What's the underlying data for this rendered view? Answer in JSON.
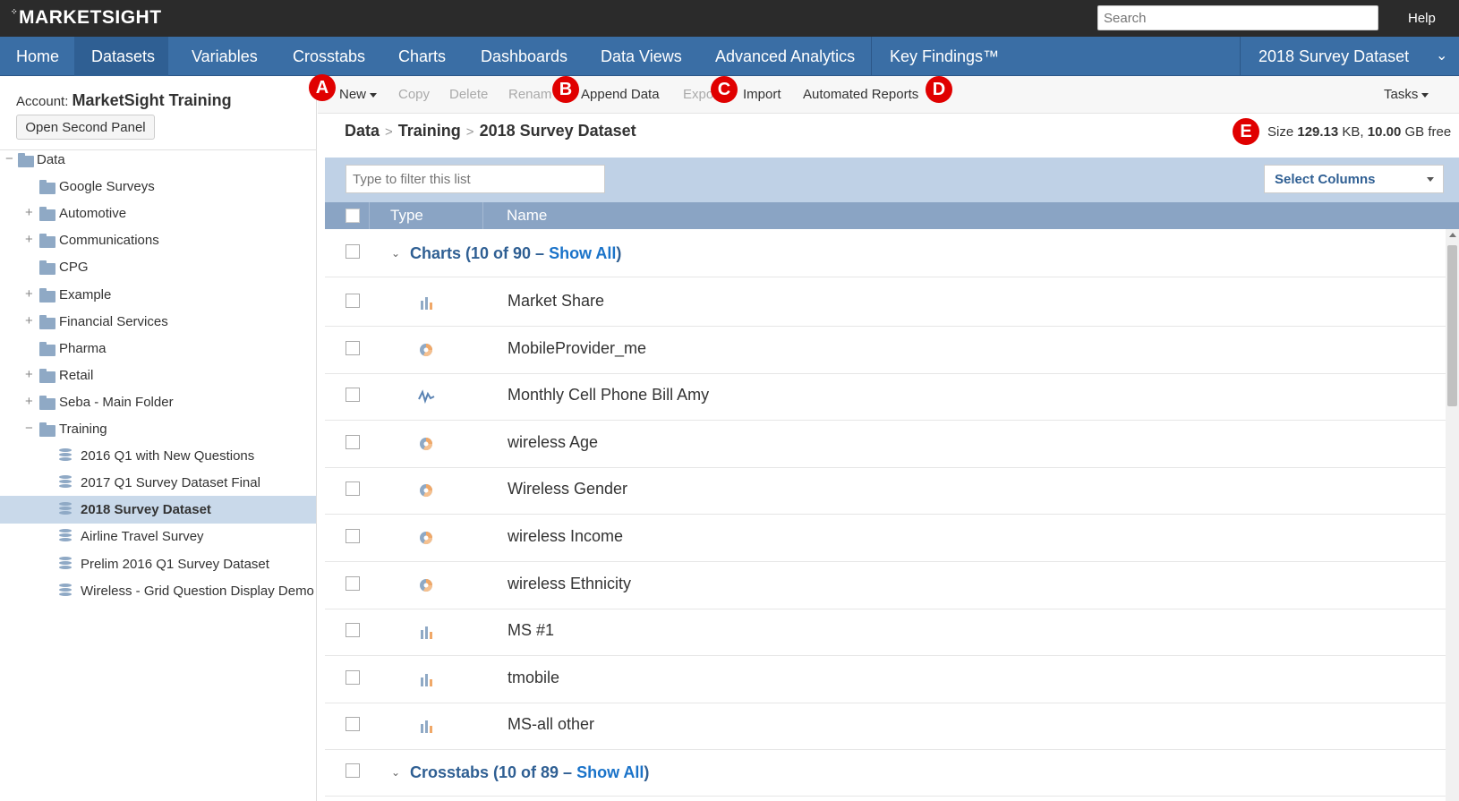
{
  "app": {
    "logo": "MARKETSIGHT",
    "search_placeholder": "Search",
    "help": "Help"
  },
  "nav": {
    "items": [
      "Home",
      "Datasets",
      "Variables",
      "Crosstabs",
      "Charts",
      "Dashboards",
      "Data Views",
      "Advanced Analytics",
      "Key Findings™"
    ],
    "active": "Datasets",
    "dataset_selector": "2018 Survey Dataset"
  },
  "left": {
    "account_label": "Account:",
    "account_name": "MarketSight Training",
    "open_second_panel": "Open Second Panel",
    "tree": [
      {
        "label": "Data",
        "type": "folder",
        "toggle": "−",
        "level": 0
      },
      {
        "label": "Google Surveys",
        "type": "folder",
        "toggle": "",
        "level": 1
      },
      {
        "label": "Automotive",
        "type": "folder",
        "toggle": "+",
        "level": 1
      },
      {
        "label": "Communications",
        "type": "folder",
        "toggle": "+",
        "level": 1
      },
      {
        "label": "CPG",
        "type": "folder",
        "toggle": "",
        "level": 1
      },
      {
        "label": "Example",
        "type": "folder",
        "toggle": "+",
        "level": 1
      },
      {
        "label": "Financial Services",
        "type": "folder",
        "toggle": "+",
        "level": 1
      },
      {
        "label": "Pharma",
        "type": "folder",
        "toggle": "",
        "level": 1
      },
      {
        "label": "Retail",
        "type": "folder",
        "toggle": "+",
        "level": 1
      },
      {
        "label": "Seba - Main Folder",
        "type": "folder",
        "toggle": "+",
        "level": 1
      },
      {
        "label": "Training",
        "type": "folder",
        "toggle": "−",
        "level": 1
      },
      {
        "label": "2016 Q1 with New Questions",
        "type": "dataset",
        "toggle": "",
        "level": 2
      },
      {
        "label": "2017 Q1 Survey Dataset Final",
        "type": "dataset",
        "toggle": "",
        "level": 2
      },
      {
        "label": "2018 Survey Dataset",
        "type": "dataset",
        "toggle": "",
        "level": 2,
        "selected": true
      },
      {
        "label": "Airline Travel Survey",
        "type": "dataset",
        "toggle": "",
        "level": 2
      },
      {
        "label": "Prelim 2016 Q1 Survey Dataset",
        "type": "dataset",
        "toggle": "",
        "level": 2
      },
      {
        "label": "Wireless - Grid Question Display Demo",
        "type": "dataset",
        "toggle": "",
        "level": 2
      }
    ]
  },
  "toolbar": {
    "new": "New",
    "copy": "Copy",
    "delete": "Delete",
    "rename": "Renam",
    "append": "Append Data",
    "export": "Expo",
    "import": "Import",
    "automated_reports": "Automated Reports",
    "tasks": "Tasks"
  },
  "markers": {
    "a": "A",
    "b": "B",
    "c": "C",
    "d": "D",
    "e": "E"
  },
  "breadcrumb": {
    "root": "Data",
    "folder": "Training",
    "current": "2018 Survey Dataset",
    "sep": ">"
  },
  "size": {
    "label": "Size",
    "value": "129.13",
    "unit": "KB,",
    "free_value": "10.00",
    "free_unit": "GB free"
  },
  "filter": {
    "placeholder": "Type to filter this list",
    "select_columns": "Select Columns"
  },
  "table": {
    "headers": {
      "type": "Type",
      "name": "Name"
    },
    "groups": [
      {
        "prefix": "Charts (10 of 90 – ",
        "link": "Show All",
        "suffix": ")"
      },
      {
        "prefix": "Crosstabs (10 of 89 – ",
        "link": "Show All",
        "suffix": ")"
      }
    ],
    "rows": [
      {
        "name": "Market Share",
        "icon": "bar-chart-icon"
      },
      {
        "name": "MobileProvider_me",
        "icon": "pie-chart-icon"
      },
      {
        "name": "Monthly Cell Phone Bill Amy",
        "icon": "line-chart-icon"
      },
      {
        "name": "wireless Age",
        "icon": "pie-chart-icon"
      },
      {
        "name": "Wireless Gender",
        "icon": "pie-chart-icon"
      },
      {
        "name": "wireless Income",
        "icon": "pie-chart-icon"
      },
      {
        "name": "wireless Ethnicity",
        "icon": "pie-chart-icon"
      },
      {
        "name": "MS #1",
        "icon": "bar-chart-icon"
      },
      {
        "name": "tmobile",
        "icon": "bar-chart-icon"
      },
      {
        "name": "MS-all other",
        "icon": "bar-chart-icon"
      }
    ]
  },
  "colors": {
    "nav": "#3a6ea5",
    "topbar": "#2b2b2b",
    "marker": "#e00000",
    "link": "#1a73c9",
    "selected": "#c9d9ea"
  }
}
